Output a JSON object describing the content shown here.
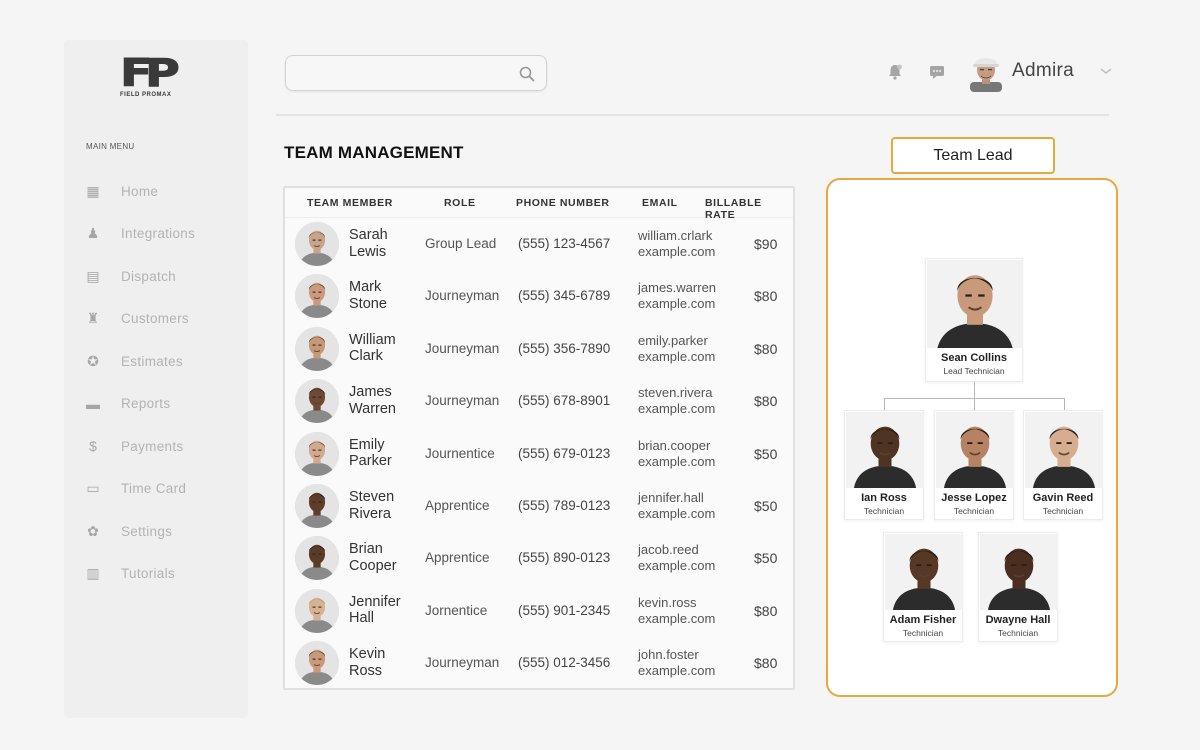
{
  "app": {
    "logo_mark": "FP",
    "logo_sub": "FIELD PROMAX"
  },
  "sidebar": {
    "menu_label": "MAIN MENU",
    "items": [
      {
        "label": "Home",
        "icon": "home-icon"
      },
      {
        "label": "Integrations",
        "icon": "user-icon"
      },
      {
        "label": "Dispatch",
        "icon": "calendar-icon"
      },
      {
        "label": "Customers",
        "icon": "group-icon"
      },
      {
        "label": "Estimates",
        "icon": "badge-icon"
      },
      {
        "label": "Reports",
        "icon": "reports-icon"
      },
      {
        "label": "Payments",
        "icon": "dollar-icon"
      },
      {
        "label": "Time Card",
        "icon": "id-card-icon"
      },
      {
        "label": "Settings",
        "icon": "gear-icon"
      },
      {
        "label": "Tutorials",
        "icon": "books-icon"
      }
    ]
  },
  "header": {
    "search_placeholder": "",
    "username": "Admira"
  },
  "page": {
    "title": "TEAM MANAGEMENT"
  },
  "table": {
    "columns": [
      "TEAM MEMBER",
      "ROLE",
      "PHONE NUMBER",
      "EMAIL",
      "BILLABLE RATE"
    ],
    "rows": [
      {
        "first": "Sarah",
        "last": "Lewis",
        "role": "Group Lead",
        "phone": "(555) 123-4567",
        "email1": "william.crlark",
        "email2": "example.com",
        "rate": "$90",
        "tone": "#c9a48a",
        "hair": "#6b4a33"
      },
      {
        "first": "Mark",
        "last": "Stone",
        "role": "Journeyman",
        "phone": "(555) 345-6789",
        "email1": "james.warren",
        "email2": "example.com",
        "rate": "$80",
        "tone": "#c99a7c",
        "hair": "#3c2a1f"
      },
      {
        "first": "William",
        "last": "Clark",
        "role": "Journeyman",
        "phone": "(555) 356-7890",
        "email1": "emily.parker",
        "email2": "example.com",
        "rate": "$80",
        "tone": "#c79878",
        "hair": "#4a3526"
      },
      {
        "first": "James",
        "last": "Warren",
        "role": "Journeyman",
        "phone": "(555) 678-8901",
        "email1": "steven.rivera",
        "email2": "example.com",
        "rate": "$80",
        "tone": "#6e4a34",
        "hair": "#1e1510"
      },
      {
        "first": "Emily",
        "last": "Parker",
        "role": "Journentice",
        "phone": "(555) 679-0123",
        "email1": "brian.cooper",
        "email2": "example.com",
        "rate": "$50",
        "tone": "#d0a98e",
        "hair": "#5b3b26"
      },
      {
        "first": "Steven",
        "last": "Rivera",
        "role": "Apprentice",
        "phone": "(555) 789-0123",
        "email1": "jennifer.hall",
        "email2": "example.com",
        "rate": "$50",
        "tone": "#5e3e2b",
        "hair": "#1a120c"
      },
      {
        "first": "Brian",
        "last": "Cooper",
        "role": "Apprentice",
        "phone": "(555) 890-0123",
        "email1": "jacob.reed",
        "email2": "example.com",
        "rate": "$50",
        "tone": "#5a3b28",
        "hair": "#18100a"
      },
      {
        "first": "Jennifer",
        "last": "Hall",
        "role": "Jornentice",
        "phone": "(555) 901-2345",
        "email1": "kevin.ross",
        "email2": "example.com",
        "rate": "$80",
        "tone": "#d6b293",
        "hair": "#b88d5e"
      },
      {
        "first": "Kevin",
        "last": "Ross",
        "role": "Journeyman",
        "phone": "(555) 012-3456",
        "email1": "john.foster",
        "email2": "example.com",
        "rate": "$80",
        "tone": "#c89a7b",
        "hair": "#3b2a1e"
      }
    ]
  },
  "team_lead": {
    "button_label": "Team Lead",
    "lead": {
      "name": "Sean Collins",
      "role": "Lead Technician",
      "tone": "#c89a7b"
    },
    "members": [
      {
        "name": "Ian Ross",
        "role": "Technician",
        "tone": "#4e3423"
      },
      {
        "name": "Jesse Lopez",
        "role": "Technician",
        "tone": "#b58363"
      },
      {
        "name": "Gavin Reed",
        "role": "Technician",
        "tone": "#d6ad8e"
      },
      {
        "name": "Adam Fisher",
        "role": "Technician",
        "tone": "#563825"
      },
      {
        "name": "Dwayne Hall",
        "role": "Technician",
        "tone": "#4a2f20"
      }
    ]
  },
  "colors": {
    "accent": "#e5a93e",
    "sidebar_text": "#b3b3b3"
  }
}
